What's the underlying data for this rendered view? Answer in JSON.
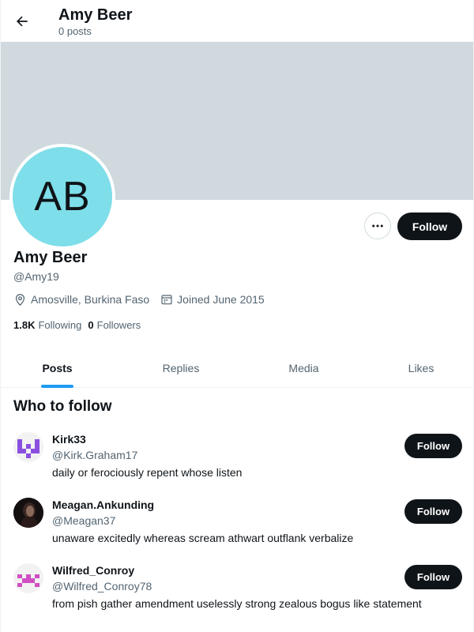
{
  "header": {
    "title": "Amy Beer",
    "post_count": "0 posts"
  },
  "profile": {
    "avatar_initials": "AB",
    "avatar_color": "#7edee9",
    "banner_color": "#cfd9de",
    "name": "Amy Beer",
    "handle": "@Amy19",
    "location": "Amosville, Burkina Faso",
    "joined": "Joined June 2015",
    "following_count": "1.8K",
    "following_label": "Following",
    "followers_count": "0",
    "followers_label": "Followers",
    "follow_label": "Follow",
    "more_icon": "more-icon"
  },
  "tabs": [
    {
      "label": "Posts",
      "active": true
    },
    {
      "label": "Replies",
      "active": false
    },
    {
      "label": "Media",
      "active": false
    },
    {
      "label": "Likes",
      "active": false
    }
  ],
  "who_to_follow": {
    "title": "Who to follow",
    "users": [
      {
        "name": "Kirk33",
        "handle": "@Kirk.Graham17",
        "bio": "daily or ferociously repent whose listen",
        "follow_label": "Follow"
      },
      {
        "name": "Meagan.Ankunding",
        "handle": "@Meagan37",
        "bio": "unaware excitedly whereas scream athwart outflank verbalize",
        "follow_label": "Follow"
      },
      {
        "name": "Wilfred_Conroy",
        "handle": "@Wilfred_Conroy78",
        "bio": "from pish gather amendment uselessly strong zealous bogus like statement",
        "follow_label": "Follow"
      }
    ]
  },
  "colors": {
    "accent": "#1d9bf0",
    "button_dark": "#0f1419",
    "muted_text": "#536471"
  }
}
